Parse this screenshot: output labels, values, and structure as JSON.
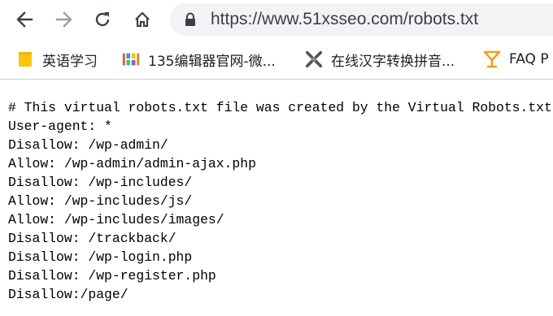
{
  "browser": {
    "url": "https://www.51xsseo.com/robots.txt",
    "icons": {
      "back": "arrow-left-icon",
      "forward": "arrow-right-icon",
      "reload": "reload-icon",
      "home": "home-icon",
      "lock": "lock-icon"
    }
  },
  "bookmarks": [
    {
      "label": "英语学习",
      "icon": "folder-icon"
    },
    {
      "label": "135编辑器官网-微...",
      "icon": "site-favicon"
    },
    {
      "label": "在线汉字转换拼音...",
      "icon": "tools-favicon"
    },
    {
      "label": "FAQ P",
      "icon": "cocktail-favicon"
    }
  ],
  "document": {
    "lines": [
      "# This virtual robots.txt file was created by the Virtual Robots.txt",
      "User-agent: *",
      "Disallow: /wp-admin/",
      "Allow: /wp-admin/admin-ajax.php",
      "Disallow: /wp-includes/",
      "Allow: /wp-includes/js/",
      "Allow: /wp-includes/images/",
      "Disallow: /trackback/",
      "Disallow: /wp-login.php",
      "Disallow: /wp-register.php",
      "Disallow:/page/"
    ]
  }
}
